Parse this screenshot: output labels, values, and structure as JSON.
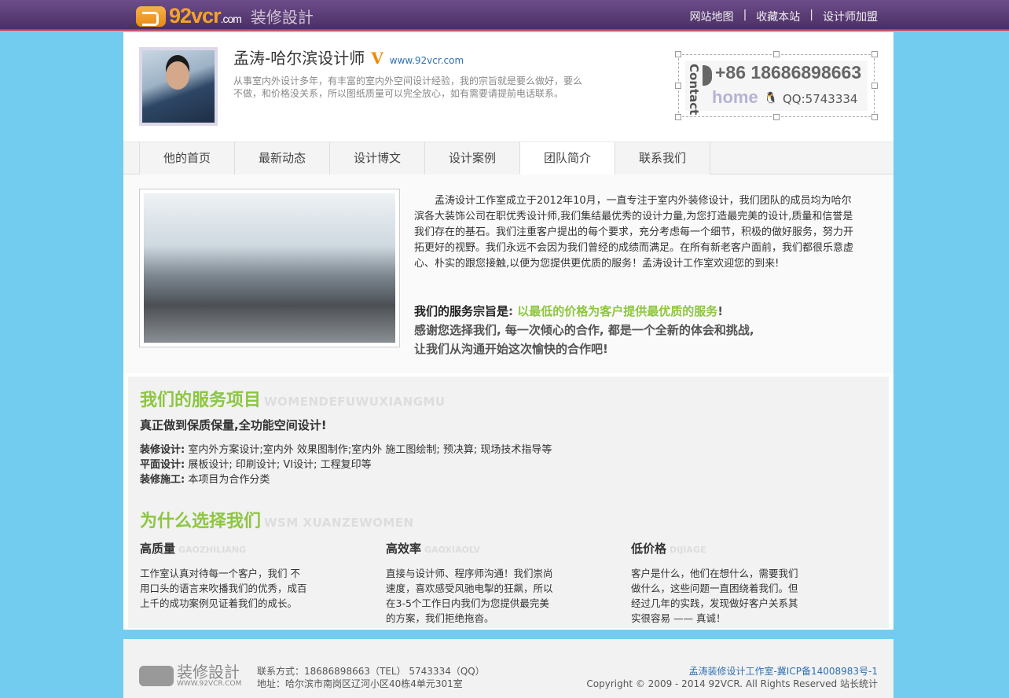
{
  "topbar": {
    "logo_text": "92vcr",
    "logo_suffix": ".com",
    "logo_cn": "装修設計",
    "links": [
      "网站地图",
      "|",
      "收藏本站",
      "|",
      "设计师加盟"
    ]
  },
  "profile": {
    "name": "孟涛-哈尔滨设计师",
    "badge": "V",
    "site": "www.92vcr.com",
    "intro": "从事室内外设计多年，有丰富的室内外空间设计经验，我的宗旨就是要么做好，要么不做，和价格没关系，所以图纸质量可以完全放心，如有需要请提前电话联系。"
  },
  "contact_card": {
    "label": "Contact",
    "phone": "+86 18686898663",
    "home": "home",
    "qq": "QQ:5743334"
  },
  "tabs": [
    "他的首页",
    "最新动态",
    "设计博文",
    "设计案例",
    "团队简介",
    "联系我们"
  ],
  "active_tab": "团队简介",
  "team": {
    "text": "孟涛设计工作室成立于2012年10月，一直专注于室内外装修设计，我们团队的成员均为哈尔滨各大装饰公司在职优秀设计师,我们集结最优秀的设计力量,为您打造最完美的设计,质量和信誉是我们存在的基石。我们注重客户提出的每个要求，充分考虑每一个细节，积极的做好服务，努力开拓更好的视野。我们永远不会因为我们曾经的成绩而满足。在所有新老客户面前，我们都很乐意虚心、朴实的跟您接触,以便为您提供更优质的服务！孟涛设计工作室欢迎您的到来!",
    "motto_label": "我们的服务宗旨是",
    "motto_sep": ": ",
    "motto_value": "以最低的价格为客户提供最优质的服务",
    "motto_end": "!",
    "line2": "感谢您选择我们, 每一次倾心的合作, 都是一个全新的体会和挑战,",
    "line3": "让我们从沟通开始这次愉快的合作吧!"
  },
  "services": {
    "title": "我们的服务项目",
    "title_en": "WOMENDEFUWUXIANGMU",
    "subtitle": "真正做到保质保量,全功能空间设计!",
    "items": [
      {
        "label": "装修设计:",
        "value": " 室内外方案设计;室内外 效果图制作;室内外 施工图绘制; 预决算; 现场技术指导等"
      },
      {
        "label": "平面设计:",
        "value": " 展板设计; 印刷设计; VI设计; 工程复印等"
      },
      {
        "label": "装修施工:",
        "value": " 本项目为合作分类"
      }
    ]
  },
  "why": {
    "title": "为什么选择我们",
    "title_en": "WSM XUANZEWOMEN",
    "cols": [
      {
        "title": "高质量",
        "en": "GAOZHILIANG",
        "text": "工作室认真对待每一个客户，我们 不用口头的语言来吹播我们的优秀，成百 上千的成功案例见证着我们的成长。"
      },
      {
        "title": "高效率",
        "en": "GAOXIAOLV",
        "text": "直接与设计师、程序师沟通！我们崇尚速度，喜欢感受风驰电掣的狂飙，所以在3-5个工作日内我们为您提供最完美的方案，我们拒绝拖沓。"
      },
      {
        "title": "低价格",
        "en": "DIJIAGE",
        "text": "客户是什么，他们在想什么，需要我们做什么，这些问题一直困绕着我们。但经过几年的实践，发现做好客户关系其实很容易 —— 真诚！"
      }
    ]
  },
  "footer": {
    "logo_cn": "装修設計",
    "logo_url": "WWW.92VCR.COM",
    "contact": "联系方式：18686898663（TEL） 5743334（QQ）",
    "address": "地址：哈尔滨市南岗区辽河小区40栋4单元301室",
    "icp": "孟涛装修设计工作室-冀ICP备14008983号-1",
    "copyright": "Copyright © 2009 - 2014 92VCR. All Rights Reserved",
    "stats": "站长统计"
  }
}
